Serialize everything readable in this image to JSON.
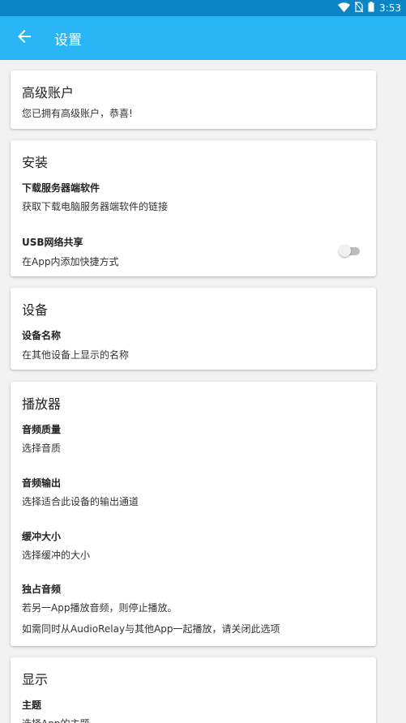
{
  "status_bar": {
    "time": "3:53",
    "icons": [
      "wifi-icon",
      "no-sim-icon",
      "battery-icon"
    ]
  },
  "app_bar": {
    "title": "设置",
    "back_icon": "arrow-back-icon"
  },
  "premium": {
    "title": "高级账户",
    "summary": "您已拥有高级账户，恭喜!"
  },
  "install": {
    "title": "安装",
    "download": {
      "title": "下载服务器端软件",
      "summary": "获取下载电脑服务器端软件的链接"
    },
    "usb": {
      "title": "USB网络共享",
      "summary": "在App内添加快捷方式",
      "enabled": false
    }
  },
  "device": {
    "title": "设备",
    "name": {
      "title": "设备名称",
      "summary": "在其他设备上显示的名称"
    }
  },
  "player": {
    "title": "播放器",
    "quality": {
      "title": "音频质量",
      "summary": "选择音质"
    },
    "output": {
      "title": "音频输出",
      "summary": "选择适合此设备的输出通道"
    },
    "buffer": {
      "title": "缓冲大小",
      "summary": "选择缓冲的大小"
    },
    "exclusive": {
      "title": "独占音频",
      "summary": "若另一App播放音频，则停止播放。",
      "note": "如需同时从AudioRelay与其他App一起播放，请关闭此选项"
    }
  },
  "display": {
    "title": "显示",
    "theme": {
      "title": "主题",
      "summary": "选择App的主题"
    }
  },
  "colors": {
    "app_bar": "#29b5f6",
    "status_bar": "#0d84c4",
    "background": "#f2f2f2"
  }
}
